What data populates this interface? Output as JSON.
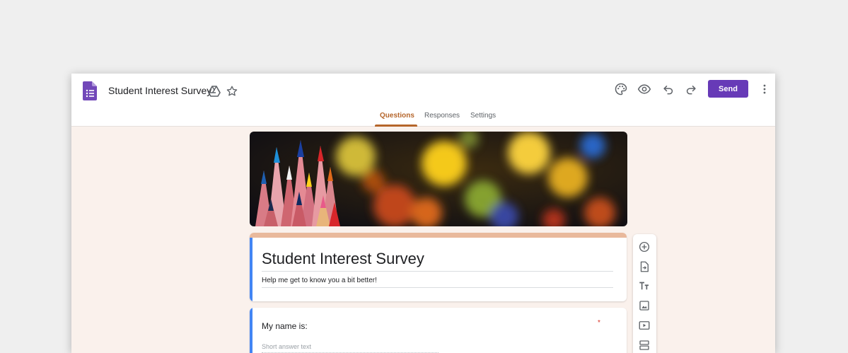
{
  "header": {
    "doc_title": "Student Interest Survey",
    "send_label": "Send",
    "brand_color": "#673ab7",
    "icons": [
      "forms-logo-icon",
      "drive-folder-icon",
      "star-icon",
      "palette-icon",
      "preview-eye-icon",
      "undo-icon",
      "redo-icon",
      "more-vert-icon"
    ]
  },
  "tabs": [
    {
      "label": "Questions",
      "active": true
    },
    {
      "label": "Responses",
      "active": false
    },
    {
      "label": "Settings",
      "active": false
    }
  ],
  "form": {
    "title": "Student Interest Survey",
    "description": "Help me get to know you a bit better!",
    "theme_color": "#e9b99c",
    "accent_color": "#4285f4"
  },
  "questions": [
    {
      "label": "My name is:",
      "required_mark": "*",
      "placeholder": "Short answer text"
    }
  ],
  "side_toolbar": [
    "add-question-icon",
    "import-questions-icon",
    "add-title-icon",
    "add-image-icon",
    "add-video-icon",
    "add-section-icon"
  ]
}
